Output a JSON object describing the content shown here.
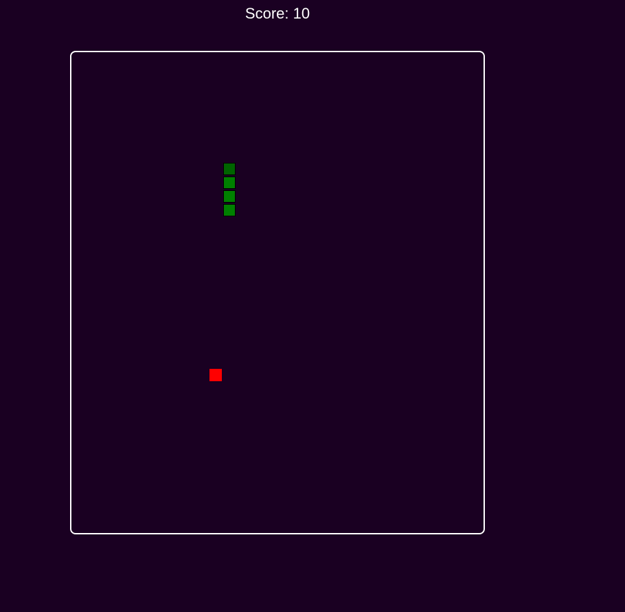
{
  "score_text": "Score: 10",
  "colors": {
    "background": "#1a0022",
    "border": "#ffffff",
    "snake_head": "#006400",
    "snake_body": "#008000",
    "food": "#ff0000"
  },
  "grid": {
    "cols": 30,
    "rows": 35
  },
  "snake": [
    {
      "col": 11,
      "row": 8,
      "part": "head"
    },
    {
      "col": 11,
      "row": 9,
      "part": "body"
    },
    {
      "col": 11,
      "row": 10,
      "part": "body"
    },
    {
      "col": 11,
      "row": 11,
      "part": "body"
    }
  ],
  "food": {
    "col": 10,
    "row": 23
  }
}
